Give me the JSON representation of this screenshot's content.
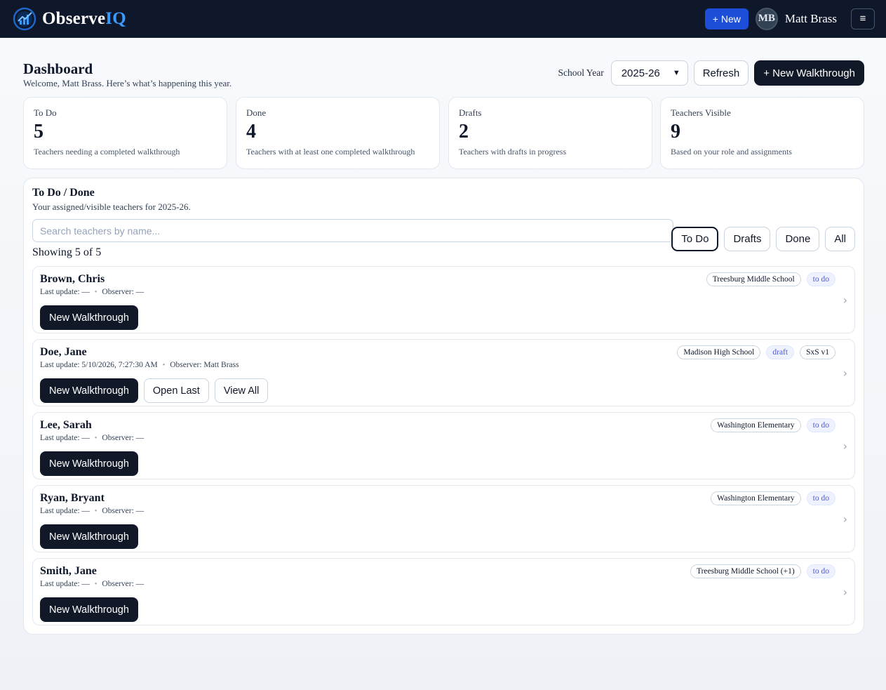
{
  "topbar": {
    "brand_main": "Observe",
    "brand_accent": "IQ",
    "new_label": "+ New",
    "avatar_initials": "MB",
    "user_name": "Matt Brass",
    "menu_label": "≡"
  },
  "header": {
    "title": "Dashboard",
    "welcome": "Welcome, Matt Brass. Here’s what’s happening this year.",
    "school_year_label": "School Year",
    "school_year_value": "2025-26",
    "refresh_label": "Refresh",
    "new_walkthrough_label": "+ New Walkthrough"
  },
  "stats": [
    {
      "label": "To Do",
      "value": "5",
      "desc": "Teachers needing a completed walkthrough"
    },
    {
      "label": "Done",
      "value": "4",
      "desc": "Teachers with at least one completed walkthrough"
    },
    {
      "label": "Drafts",
      "value": "2",
      "desc": "Teachers with drafts in progress"
    },
    {
      "label": "Teachers Visible",
      "value": "9",
      "desc": "Based on your role and assignments"
    }
  ],
  "panel": {
    "title": "To Do / Done",
    "subtitle": "Your assigned/visible teachers for 2025-26.",
    "search_placeholder": "Search teachers by name...",
    "filters": [
      "To Do",
      "Drafts",
      "Done",
      "All"
    ],
    "active_filter": "To Do",
    "showing": "Showing 5 of 5"
  },
  "teachers": [
    {
      "name": "Brown, Chris",
      "last_update": "Last update: —",
      "observer": "Observer: —",
      "school": "Treesburg Middle School",
      "status": "to do",
      "extra_tag": "",
      "actions": {
        "new": "New Walkthrough"
      }
    },
    {
      "name": "Doe, Jane",
      "last_update": "Last update: 5/10/2026, 7:27:30 AM",
      "observer": "Observer: Matt Brass",
      "school": "Madison High School",
      "status": "draft",
      "extra_tag": "SxS v1",
      "actions": {
        "new": "New Walkthrough",
        "open_last": "Open Last",
        "view_all": "View All"
      }
    },
    {
      "name": "Lee, Sarah",
      "last_update": "Last update: —",
      "observer": "Observer: —",
      "school": "Washington Elementary",
      "status": "to do",
      "extra_tag": "",
      "actions": {
        "new": "New Walkthrough"
      }
    },
    {
      "name": "Ryan, Bryant",
      "last_update": "Last update: —",
      "observer": "Observer: —",
      "school": "Washington Elementary",
      "status": "to do",
      "extra_tag": "",
      "actions": {
        "new": "New Walkthrough"
      }
    },
    {
      "name": "Smith, Jane",
      "last_update": "Last update: —",
      "observer": "Observer: —",
      "school": "Treesburg Middle School (+1)",
      "status": "to do",
      "extra_tag": "",
      "actions": {
        "new": "New Walkthrough"
      }
    }
  ],
  "colors": {
    "topbar_bg": "#0f172a",
    "brand_accent": "#3b9bff",
    "primary_blue": "#1d4ed8",
    "dark_button": "#111827",
    "status_tag_bg": "#eef2ff",
    "status_tag_text": "#4f5bd5"
  }
}
